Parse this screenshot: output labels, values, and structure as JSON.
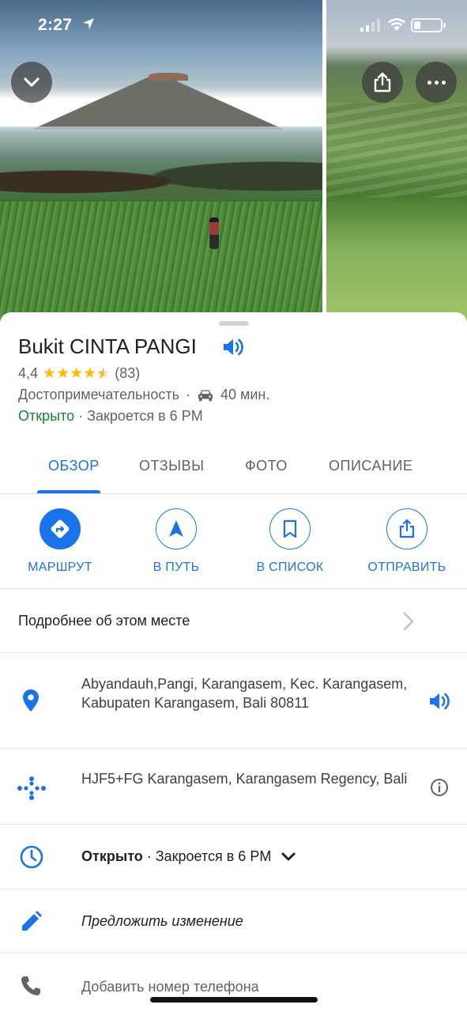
{
  "status_bar": {
    "time": "2:27"
  },
  "place": {
    "name": "Bukit CINTA PANGI",
    "rating": "4,4",
    "rating_value": 4.4,
    "review_count": "(83)",
    "category": "Достопримечательность",
    "separator": "·",
    "drive_time": "40 мин.",
    "open_status": "Открыто",
    "closes_text": "· Закроется в 6 PM"
  },
  "tabs": [
    {
      "label": "ОБЗОР",
      "active": true
    },
    {
      "label": "ОТЗЫВЫ",
      "active": false
    },
    {
      "label": "ФОТО",
      "active": false
    },
    {
      "label": "ОПИСАНИЕ",
      "active": false
    }
  ],
  "actions": [
    {
      "label": "МАРШРУТ",
      "icon": "directions-icon"
    },
    {
      "label": "В ПУТЬ",
      "icon": "navigation-arrow-icon"
    },
    {
      "label": "В СПИСОК",
      "icon": "bookmark-icon"
    },
    {
      "label": "ОТПРАВИТЬ",
      "icon": "share-icon"
    }
  ],
  "details": {
    "more_about": "Подробнее об этом месте",
    "address": "Abyandauh,Pangi, Karangasem, Kec. Karangasem, Kabupaten Karangasem, Bali 80811",
    "plus_code": "HJF5+FG Karangasem, Karangasem Regency, Bali",
    "hours_open": "Открыто",
    "hours_closes": " · Закроется в 6 PM",
    "suggest_edit": "Предложить изменение",
    "add_phone": "Добавить номер телефона"
  },
  "colors": {
    "accent": "#1a73e8",
    "open_green": "#188038",
    "star": "#fbbc04"
  }
}
